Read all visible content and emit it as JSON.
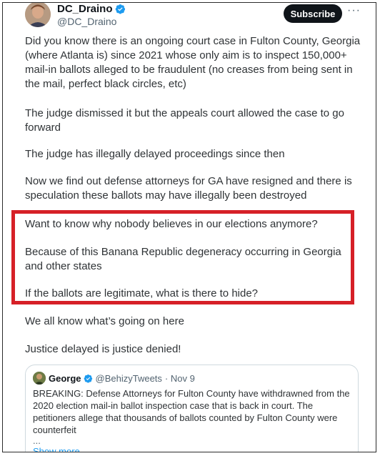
{
  "author": {
    "display_name": "DC_Draino",
    "handle": "@DC_Draino",
    "verified_icon": "verified-badge-icon"
  },
  "actions": {
    "subscribe_label": "Subscribe",
    "more_label": "···"
  },
  "tweet": {
    "paragraphs": [
      "Did you know there is an ongoing court case in Fulton County, Georgia (where Atlanta is) since 2021 whose only aim is to inspect 150,000+ mail-in ballots alleged to be fraudulent (no creases from being sent in the mail, perfect black circles, etc)",
      "The judge dismissed it but the appeals court allowed the case to go forward",
      "The judge has illegally delayed proceedings since then",
      "Now we find out defense attorneys for GA have resigned and there is speculation these ballots may have illegally been destroyed",
      "Want to know why nobody believes in our elections anymore?",
      "Because of this Banana Republic degeneracy occurring in Georgia and other states",
      "If the ballots are legitimate, what is there to hide?",
      "We all know what’s going on here",
      "Justice delayed is justice denied!"
    ]
  },
  "quote": {
    "display_name": "George",
    "handle": "@BehizyTweets",
    "date": "· Nov 9",
    "text": "BREAKING: Defense Attorneys for Fulton County have withdrawned from the 2020 election mail-in ballot inspection case that is back in court. The petitioners allege that thousands of ballots counted by Fulton County were counterfeit",
    "ellipsis": "...",
    "show_more": "Show more"
  },
  "colors": {
    "highlight_border": "#d62027",
    "link_blue": "#1d9bf0",
    "verified_blue": "#1d9bf0"
  }
}
